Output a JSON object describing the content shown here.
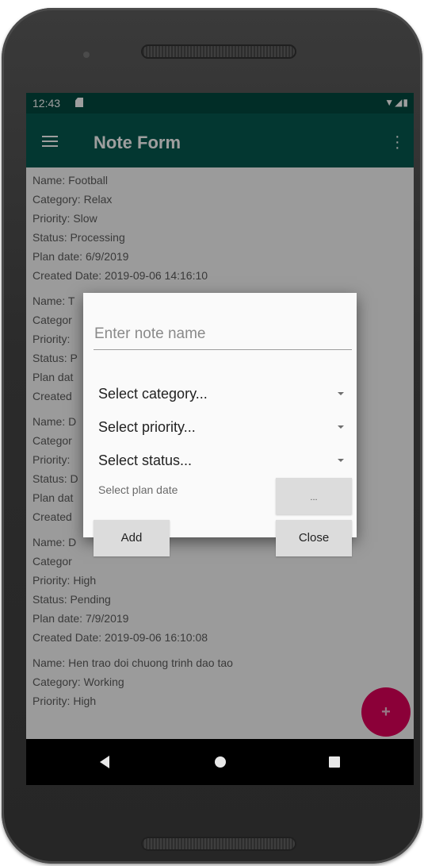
{
  "status_bar": {
    "time": "12:43",
    "icons": "▼◢▮"
  },
  "app_bar": {
    "title": "Note Form"
  },
  "notes": [
    {
      "name": "Name: Football",
      "category": "Category: Relax",
      "priority": "Priority: Slow",
      "status": "Status: Processing",
      "plan_date": "Plan date: 6/9/2019",
      "created": "Created Date: 2019-09-06 14:16:10"
    },
    {
      "name": "Name: T",
      "category": "Categor",
      "priority": "Priority:",
      "status": "Status: P",
      "plan_date": "Plan dat",
      "created": "Created"
    },
    {
      "name": "Name: D",
      "category": "Categor",
      "priority": "Priority:",
      "status": "Status: D",
      "plan_date": "Plan dat",
      "created": "Created"
    },
    {
      "name": "Name: D",
      "category": "Categor",
      "priority": "Priority: High",
      "status": "Status: Pending",
      "plan_date": "Plan date: 7/9/2019",
      "created": "Created Date: 2019-09-06 16:10:08"
    },
    {
      "name": "Name: Hen trao doi chuong trinh dao tao",
      "category": "Category: Working",
      "priority": "Priority: High"
    }
  ],
  "dialog": {
    "name_placeholder": "Enter note name",
    "category_label": "Select category...",
    "priority_label": "Select priority...",
    "status_label": "Select status...",
    "plan_date_label": "Select plan date",
    "date_button_label": "...",
    "add_label": "Add",
    "close_label": "Close"
  },
  "fab": {
    "icon": "plus-icon",
    "glyph": "+"
  },
  "colors": {
    "status_bar": "#03493f",
    "app_bar": "#065a4f",
    "fab": "#e0005a"
  }
}
